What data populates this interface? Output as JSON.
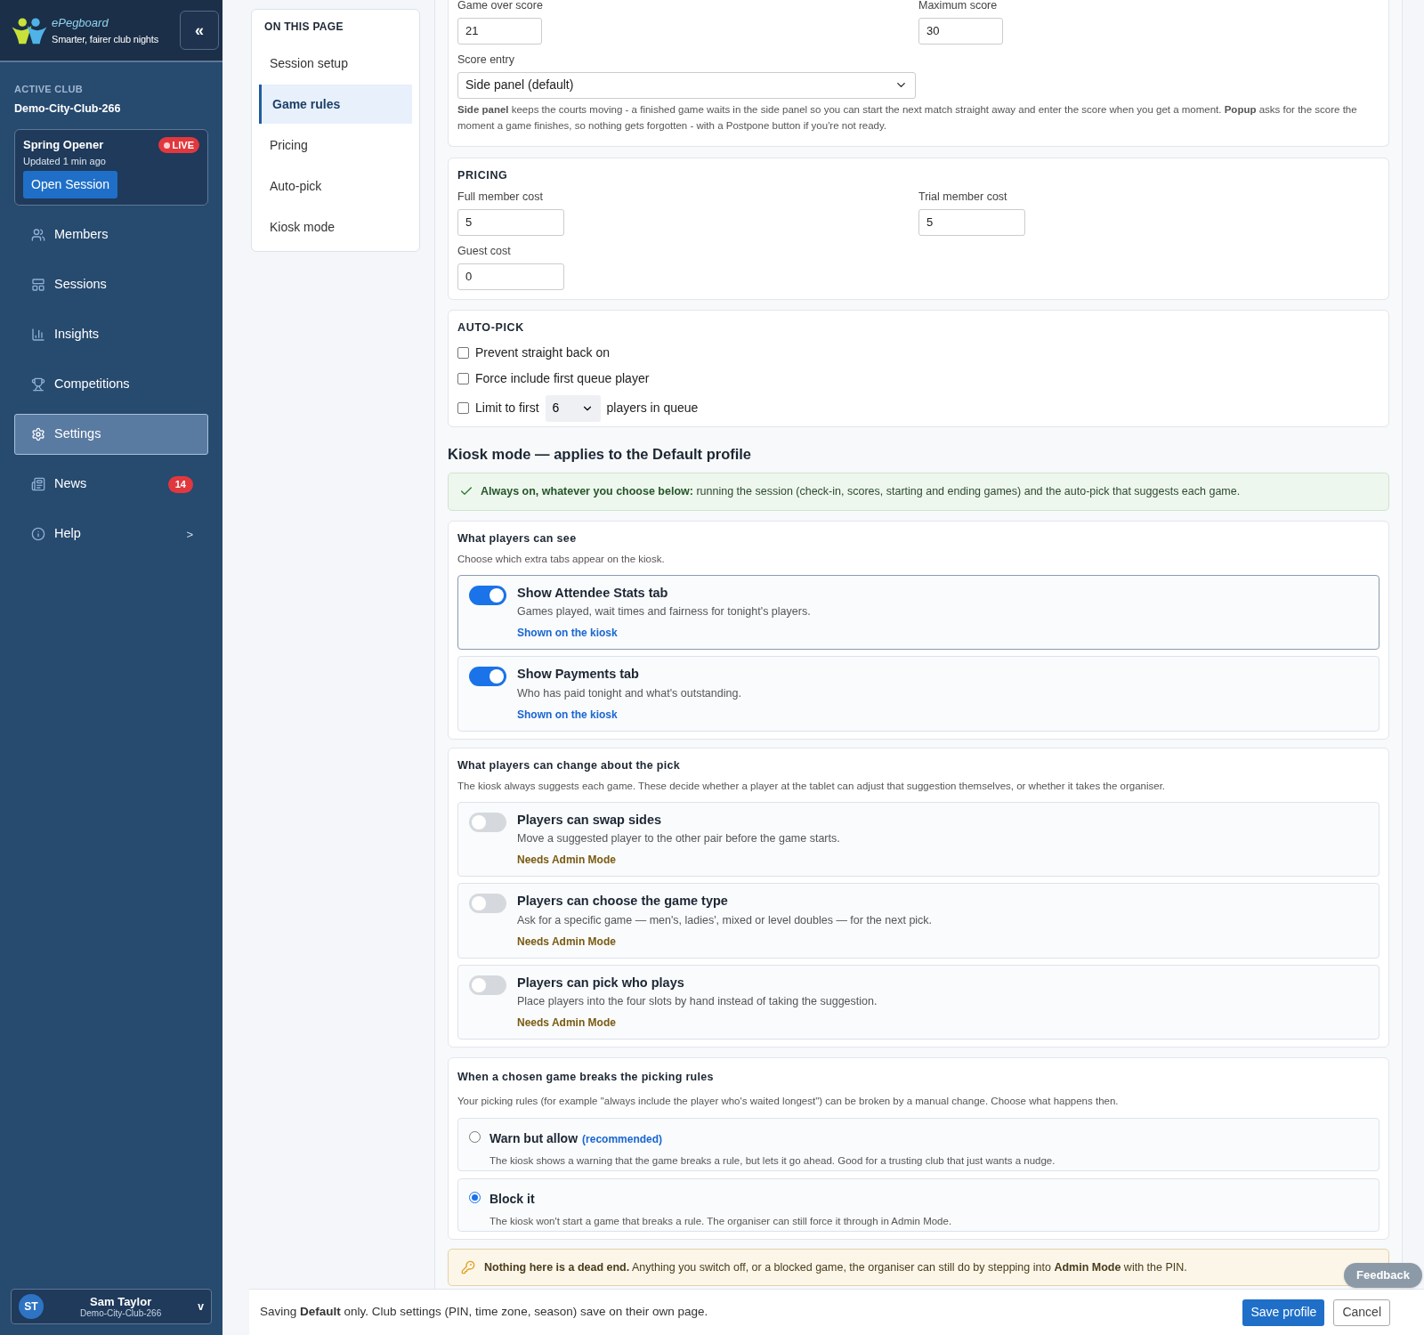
{
  "brand": {
    "name": "ePegboard",
    "tagline": "Smarter, fairer club nights",
    "collapse": "«"
  },
  "sidebar": {
    "club_label": "ACTIVE CLUB",
    "club_name": "Demo-City-Club-266",
    "session": {
      "name": "Spring Opener",
      "status": "LIVE",
      "updated": "Updated 1 min ago",
      "button": "Open Session"
    },
    "items": [
      {
        "label": "Members",
        "selected": false
      },
      {
        "label": "Sessions",
        "selected": false
      },
      {
        "label": "Insights",
        "selected": false
      },
      {
        "label": "Competitions",
        "selected": false
      },
      {
        "label": "Settings",
        "selected": true
      },
      {
        "label": "News",
        "selected": false,
        "badge": "14"
      },
      {
        "label": "Help",
        "selected": false,
        "chevron": ">"
      }
    ],
    "user": {
      "initials": "ST",
      "name": "Sam Taylor",
      "club": "Demo-City-Club-266",
      "caret": "v"
    }
  },
  "page_nav": {
    "title": "ON THIS PAGE",
    "items": [
      {
        "label": "Session setup",
        "selected": false
      },
      {
        "label": "Game rules",
        "selected": true
      },
      {
        "label": "Pricing",
        "selected": false
      },
      {
        "label": "Auto-pick",
        "selected": false
      },
      {
        "label": "Kiosk mode",
        "selected": false
      }
    ]
  },
  "game_rules": {
    "fields": [
      {
        "label": "Game over score",
        "value": "21"
      },
      {
        "label": "Maximum score",
        "value": "30"
      }
    ],
    "score_entry": {
      "label": "Score entry",
      "value": "Side panel (default)"
    },
    "help": "**Side panel** keeps the courts moving - a finished game waits in the side panel so you can start the next match straight away and enter the score when you get a moment. **Popup** asks for the score the moment a game finishes, so nothing gets forgotten - with a Postpone button if you're not ready."
  },
  "pricing": {
    "title": "PRICING",
    "fields": [
      {
        "label": "Full member cost",
        "value": "5"
      },
      {
        "label": "Trial member cost",
        "value": "5"
      },
      {
        "label": "Guest cost",
        "value": "0"
      }
    ]
  },
  "auto_pick": {
    "title": "AUTO-PICK",
    "options": [
      {
        "kind": "checkbox",
        "label": "Prevent straight back on",
        "checked": false
      },
      {
        "kind": "checkbox",
        "label": "Force include first queue player",
        "checked": false
      },
      {
        "kind": "limit",
        "label": "Limit to first",
        "value": "6",
        "suffix": "players in queue",
        "checked": false
      }
    ]
  },
  "kiosk": {
    "heading": "Kiosk mode — applies to the Default profile",
    "notice": "**Always on, whatever you choose below:** running the session (check-in, scores, starting and ending games) and the auto-pick that suggests each game.",
    "sections": [
      {
        "title": "What players can see",
        "subtitle": "Choose which extra tabs appear on the kiosk.",
        "toggles": [
          {
            "title": "Show Attendee Stats tab",
            "description": "Games played, wait times and fairness for tonight's players.",
            "status": "Shown on the kiosk",
            "on": true,
            "focused": true
          },
          {
            "title": "Show Payments tab",
            "description": "Who has paid tonight and what's outstanding.",
            "status": "Shown on the kiosk",
            "on": true,
            "focused": false
          }
        ]
      },
      {
        "title": "What players can change about the pick",
        "subtitle": "The kiosk always suggests each game. These decide whether a player at the tablet can adjust that suggestion themselves, or whether it takes the organiser.",
        "toggles": [
          {
            "title": "Players can swap sides",
            "description": "Move a suggested player to the other pair before the game starts.",
            "status": "Needs Admin Mode",
            "on": false,
            "focused": false
          },
          {
            "title": "Players can choose the game type",
            "description": "Ask for a specific game — men's, ladies', mixed or level doubles — for the next pick.",
            "status": "Needs Admin Mode",
            "on": false,
            "focused": false
          },
          {
            "title": "Players can pick who plays",
            "description": "Place players into the four slots by hand instead of taking the suggestion.",
            "status": "Needs Admin Mode",
            "on": false,
            "focused": false
          }
        ]
      }
    ],
    "rules": {
      "title": "When a chosen game breaks the picking rules",
      "subtitle": "Your picking rules (for example \"always include the player who's waited longest\") can be broken by a manual change. Choose what happens then.",
      "options": [
        {
          "label": "Warn but allow",
          "tag": "(recommended)",
          "description": "The kiosk shows a warning that the game breaks a rule, but lets it go ahead. Good for a trusting club that just wants a nudge.",
          "selected": false
        },
        {
          "label": "Block it",
          "description": "The kiosk won't start a game that breaks a rule. The organiser can still force it through in Admin Mode.",
          "selected": true
        }
      ]
    },
    "tip": "**Nothing here is a dead end.** Anything you switch off, or a blocked game, the organiser can still do by stepping into **Admin Mode** with the PIN."
  },
  "footer": {
    "text": "Saving **Default** only. Club settings (PIN, time zone, season) save on their own page.",
    "save": "Save profile",
    "cancel": "Cancel",
    "feedback": "Feedback"
  }
}
